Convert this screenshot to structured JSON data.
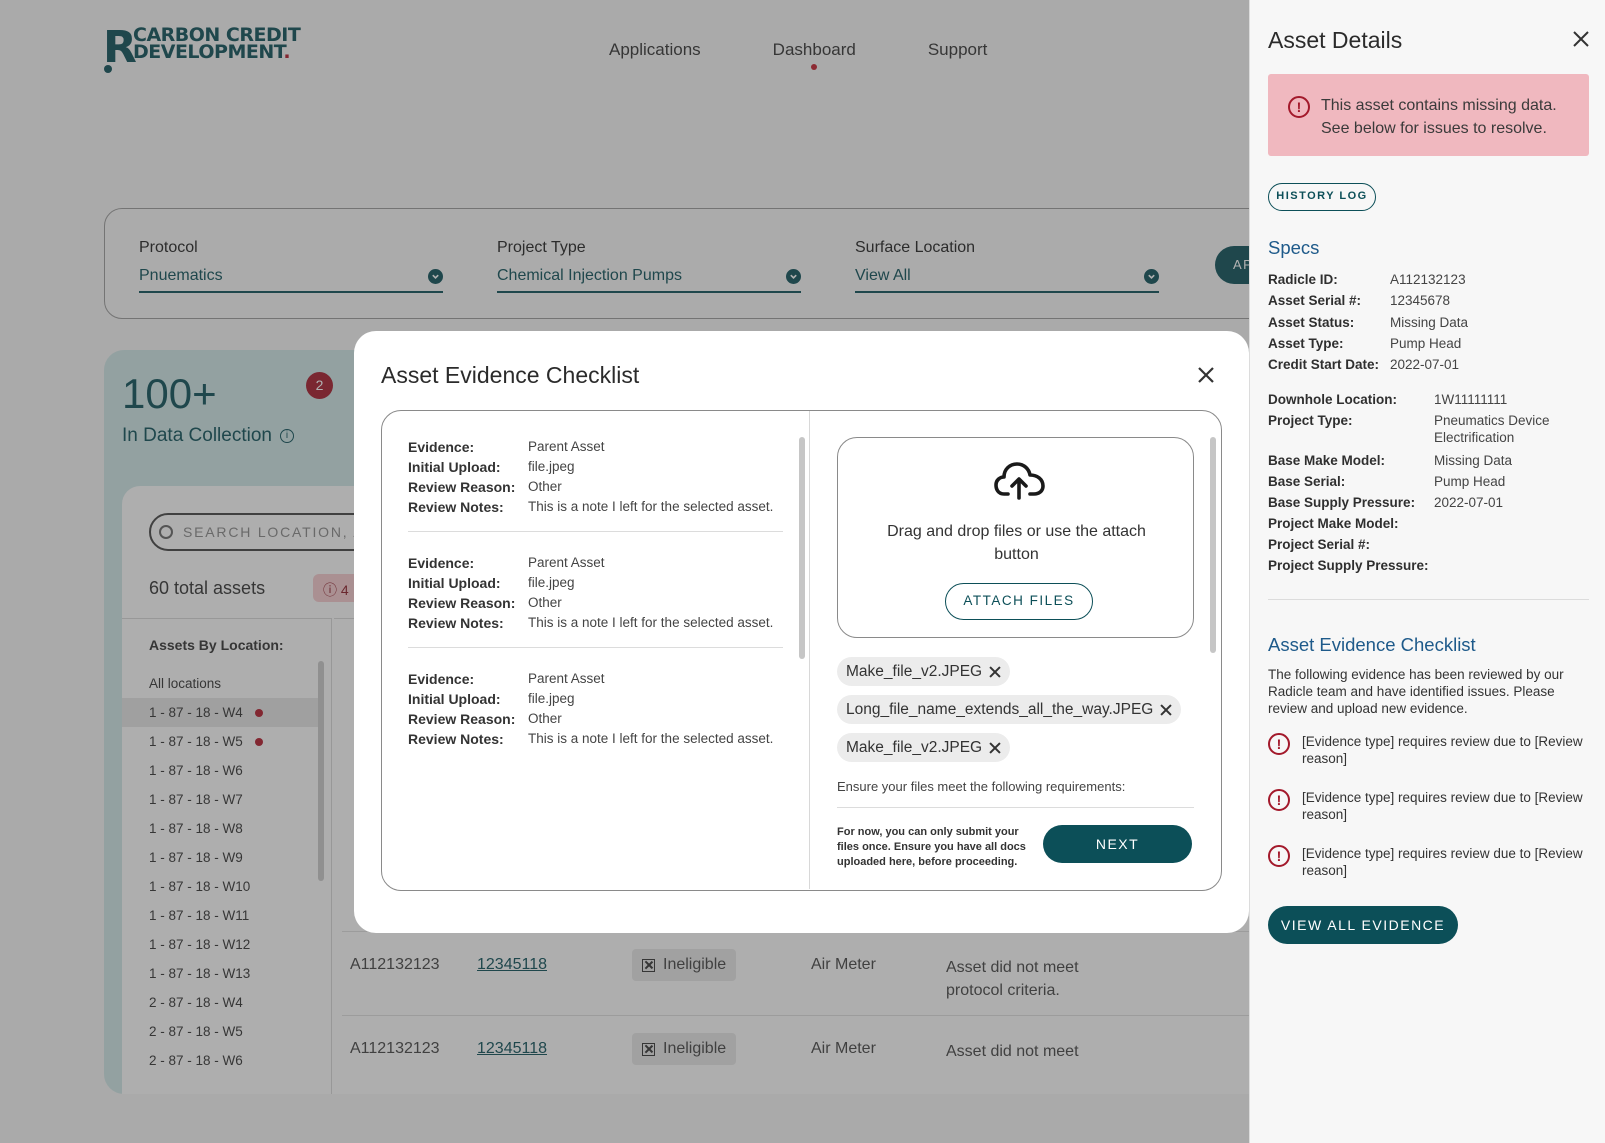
{
  "brand": {
    "mark": "R",
    "line1": "CARBON CREDIT",
    "line2": "DEVELOPMENT",
    "line2_end": "."
  },
  "nav": {
    "items": [
      "Applications",
      "Dashboard",
      "Support"
    ],
    "active": "Dashboard"
  },
  "filters": {
    "protocol": {
      "label": "Protocol",
      "value": "Pnuematics"
    },
    "project_type": {
      "label": "Project Type",
      "value": "Chemical Injection Pumps"
    },
    "surface_location": {
      "label": "Surface Location",
      "value": "View All"
    },
    "apply_label": "AP"
  },
  "dashboard": {
    "count": "100+",
    "badge": "2",
    "label": "In Data Collection",
    "search_placeholder": "SEARCH LOCATION, AS",
    "total_assets": "60 total assets",
    "missing_count": "4",
    "locations_title": "Assets By Location:",
    "locations": [
      {
        "label": "All locations",
        "flag": false,
        "selected": false
      },
      {
        "label": "1 - 87 - 18 - W4",
        "flag": true,
        "selected": true
      },
      {
        "label": "1 - 87 - 18 - W5",
        "flag": true,
        "selected": false
      },
      {
        "label": "1 - 87 - 18 - W6",
        "flag": false,
        "selected": false
      },
      {
        "label": "1 - 87 - 18 - W7",
        "flag": false,
        "selected": false
      },
      {
        "label": "1 - 87 - 18 - W8",
        "flag": false,
        "selected": false
      },
      {
        "label": "1 - 87 - 18 - W9",
        "flag": false,
        "selected": false
      },
      {
        "label": "1 - 87 - 18 - W10",
        "flag": false,
        "selected": false
      },
      {
        "label": "1 - 87 - 18 - W11",
        "flag": false,
        "selected": false
      },
      {
        "label": "1 - 87 - 18 - W12",
        "flag": false,
        "selected": false
      },
      {
        "label": "1 - 87 - 18 - W13",
        "flag": false,
        "selected": false
      },
      {
        "label": "2 - 87 - 18 - W4",
        "flag": false,
        "selected": false
      },
      {
        "label": "2 - 87 - 18 - W5",
        "flag": false,
        "selected": false
      },
      {
        "label": "2 - 87 - 18 - W6",
        "flag": false,
        "selected": false
      }
    ],
    "rows": [
      {
        "id": "A112132123",
        "serial": "12345118",
        "status": "Ineligible",
        "type": "Air Meter",
        "reason": "Asset did not meet protocol criteria."
      },
      {
        "id": "A112132123",
        "serial": "12345118",
        "status": "Ineligible",
        "type": "Air Meter",
        "reason": "Asset did not meet"
      }
    ]
  },
  "modal": {
    "title": "Asset Evidence Checklist",
    "labels": {
      "evidence": "Evidence:",
      "initial_upload": "Initial Upload:",
      "review_reason": "Review Reason:",
      "review_notes": "Review Notes:"
    },
    "evidence": [
      {
        "evidence": "Parent Asset",
        "initial_upload": "file.jpeg",
        "review_reason": "Other",
        "review_notes": "This is a note I left for the selected asset."
      },
      {
        "evidence": "Parent Asset",
        "initial_upload": "file.jpeg",
        "review_reason": "Other",
        "review_notes": "This is a note I left for the selected asset."
      },
      {
        "evidence": "Parent Asset",
        "initial_upload": "file.jpeg",
        "review_reason": "Other",
        "review_notes": "This is a note I left for the selected asset."
      }
    ],
    "dropzone_text": "Drag and drop files or use the attach button",
    "attach_label": "ATTACH FILES",
    "files": [
      "Make_file_v2.JPEG",
      "Long_file_name_extends_all_the_way.JPEG",
      "Make_file_v2.JPEG"
    ],
    "requirements": "Ensure your files meet the following requirements:",
    "note": "For now, you can only submit your files once. Ensure you have all docs uploaded here, before proceeding.",
    "next_label": "NEXT"
  },
  "drawer": {
    "title": "Asset Details",
    "alert": "This asset contains missing data. See below for issues to resolve.",
    "history_label": "HISTORY LOG",
    "specs_title": "Specs",
    "specs": [
      {
        "k": "Radicle ID:",
        "v": "A112132123"
      },
      {
        "k": "Asset Serial #:",
        "v": "12345678"
      },
      {
        "k": "Asset Status:",
        "v": "Missing Data"
      },
      {
        "k": "Asset Type:",
        "v": "Pump Head"
      },
      {
        "k": "Credit Start Date:",
        "v": "2022-07-01"
      }
    ],
    "specs2": [
      {
        "k": "Downhole Location:",
        "v": "1W11111111"
      },
      {
        "k": "Project Type:",
        "v": "Pneumatics Device Electrification"
      },
      {
        "k": "Base Make Model:",
        "v": "Missing Data"
      },
      {
        "k": "Base Serial:",
        "v": "Pump Head"
      },
      {
        "k": "Base Supply Pressure:",
        "v": "2022-07-01"
      },
      {
        "k": "Project Make Model:",
        "v": ""
      },
      {
        "k": "Project Serial #:",
        "v": ""
      },
      {
        "k": "Project Supply Pressure:",
        "v": ""
      }
    ],
    "checklist_title": "Asset Evidence Checklist",
    "checklist_desc": "The following evidence has been reviewed by our Radicle team and have identified issues. Please review and upload new evidence.",
    "issues": [
      "[Evidence type] requires review due to [Review reason]",
      "[Evidence type] requires review due to [Review reason]",
      "[Evidence type] requires review due to [Review reason]"
    ],
    "view_all_label": "VIEW ALL EVIDENCE"
  },
  "colors": {
    "primary": "#0c4f58",
    "alert": "#a3192b",
    "heading_blue": "#1e5a8a"
  }
}
